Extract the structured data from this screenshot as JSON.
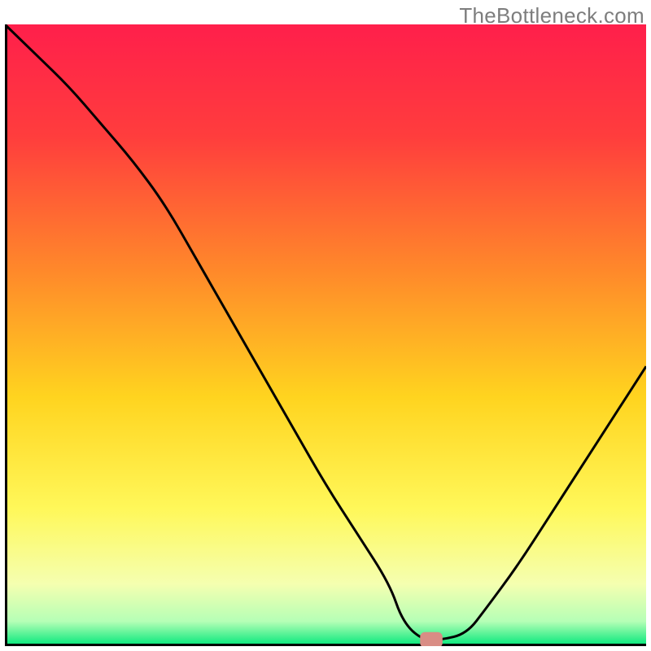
{
  "watermark": "TheBottleneck.com",
  "chart_data": {
    "type": "line",
    "title": "",
    "xlabel": "",
    "ylabel": "",
    "xlim": [
      0,
      100
    ],
    "ylim": [
      0,
      100
    ],
    "grid": false,
    "legend": false,
    "series": [
      {
        "name": "curve",
        "x": [
          0,
          5,
          10,
          15,
          20,
          25,
          30,
          35,
          40,
          45,
          50,
          55,
          60,
          62,
          65,
          68,
          72,
          75,
          80,
          85,
          90,
          95,
          100
        ],
        "y": [
          100,
          95,
          90,
          84,
          78,
          71,
          62,
          53,
          44,
          35,
          26,
          18,
          10,
          4,
          1,
          1,
          2,
          6,
          13,
          21,
          29,
          37,
          45
        ]
      }
    ],
    "marker": {
      "x": 66.5,
      "y": 1,
      "width": 3.5,
      "height": 2.5,
      "color": "#d98d85"
    },
    "background_gradient": {
      "stops": [
        {
          "offset": 0.0,
          "color": "#ff1f4b"
        },
        {
          "offset": 0.18,
          "color": "#ff3d3d"
        },
        {
          "offset": 0.4,
          "color": "#ff8a2a"
        },
        {
          "offset": 0.6,
          "color": "#ffd41f"
        },
        {
          "offset": 0.78,
          "color": "#fff85a"
        },
        {
          "offset": 0.9,
          "color": "#f5ffb0"
        },
        {
          "offset": 0.96,
          "color": "#b6ffb6"
        },
        {
          "offset": 1.0,
          "color": "#00e77a"
        }
      ]
    }
  }
}
